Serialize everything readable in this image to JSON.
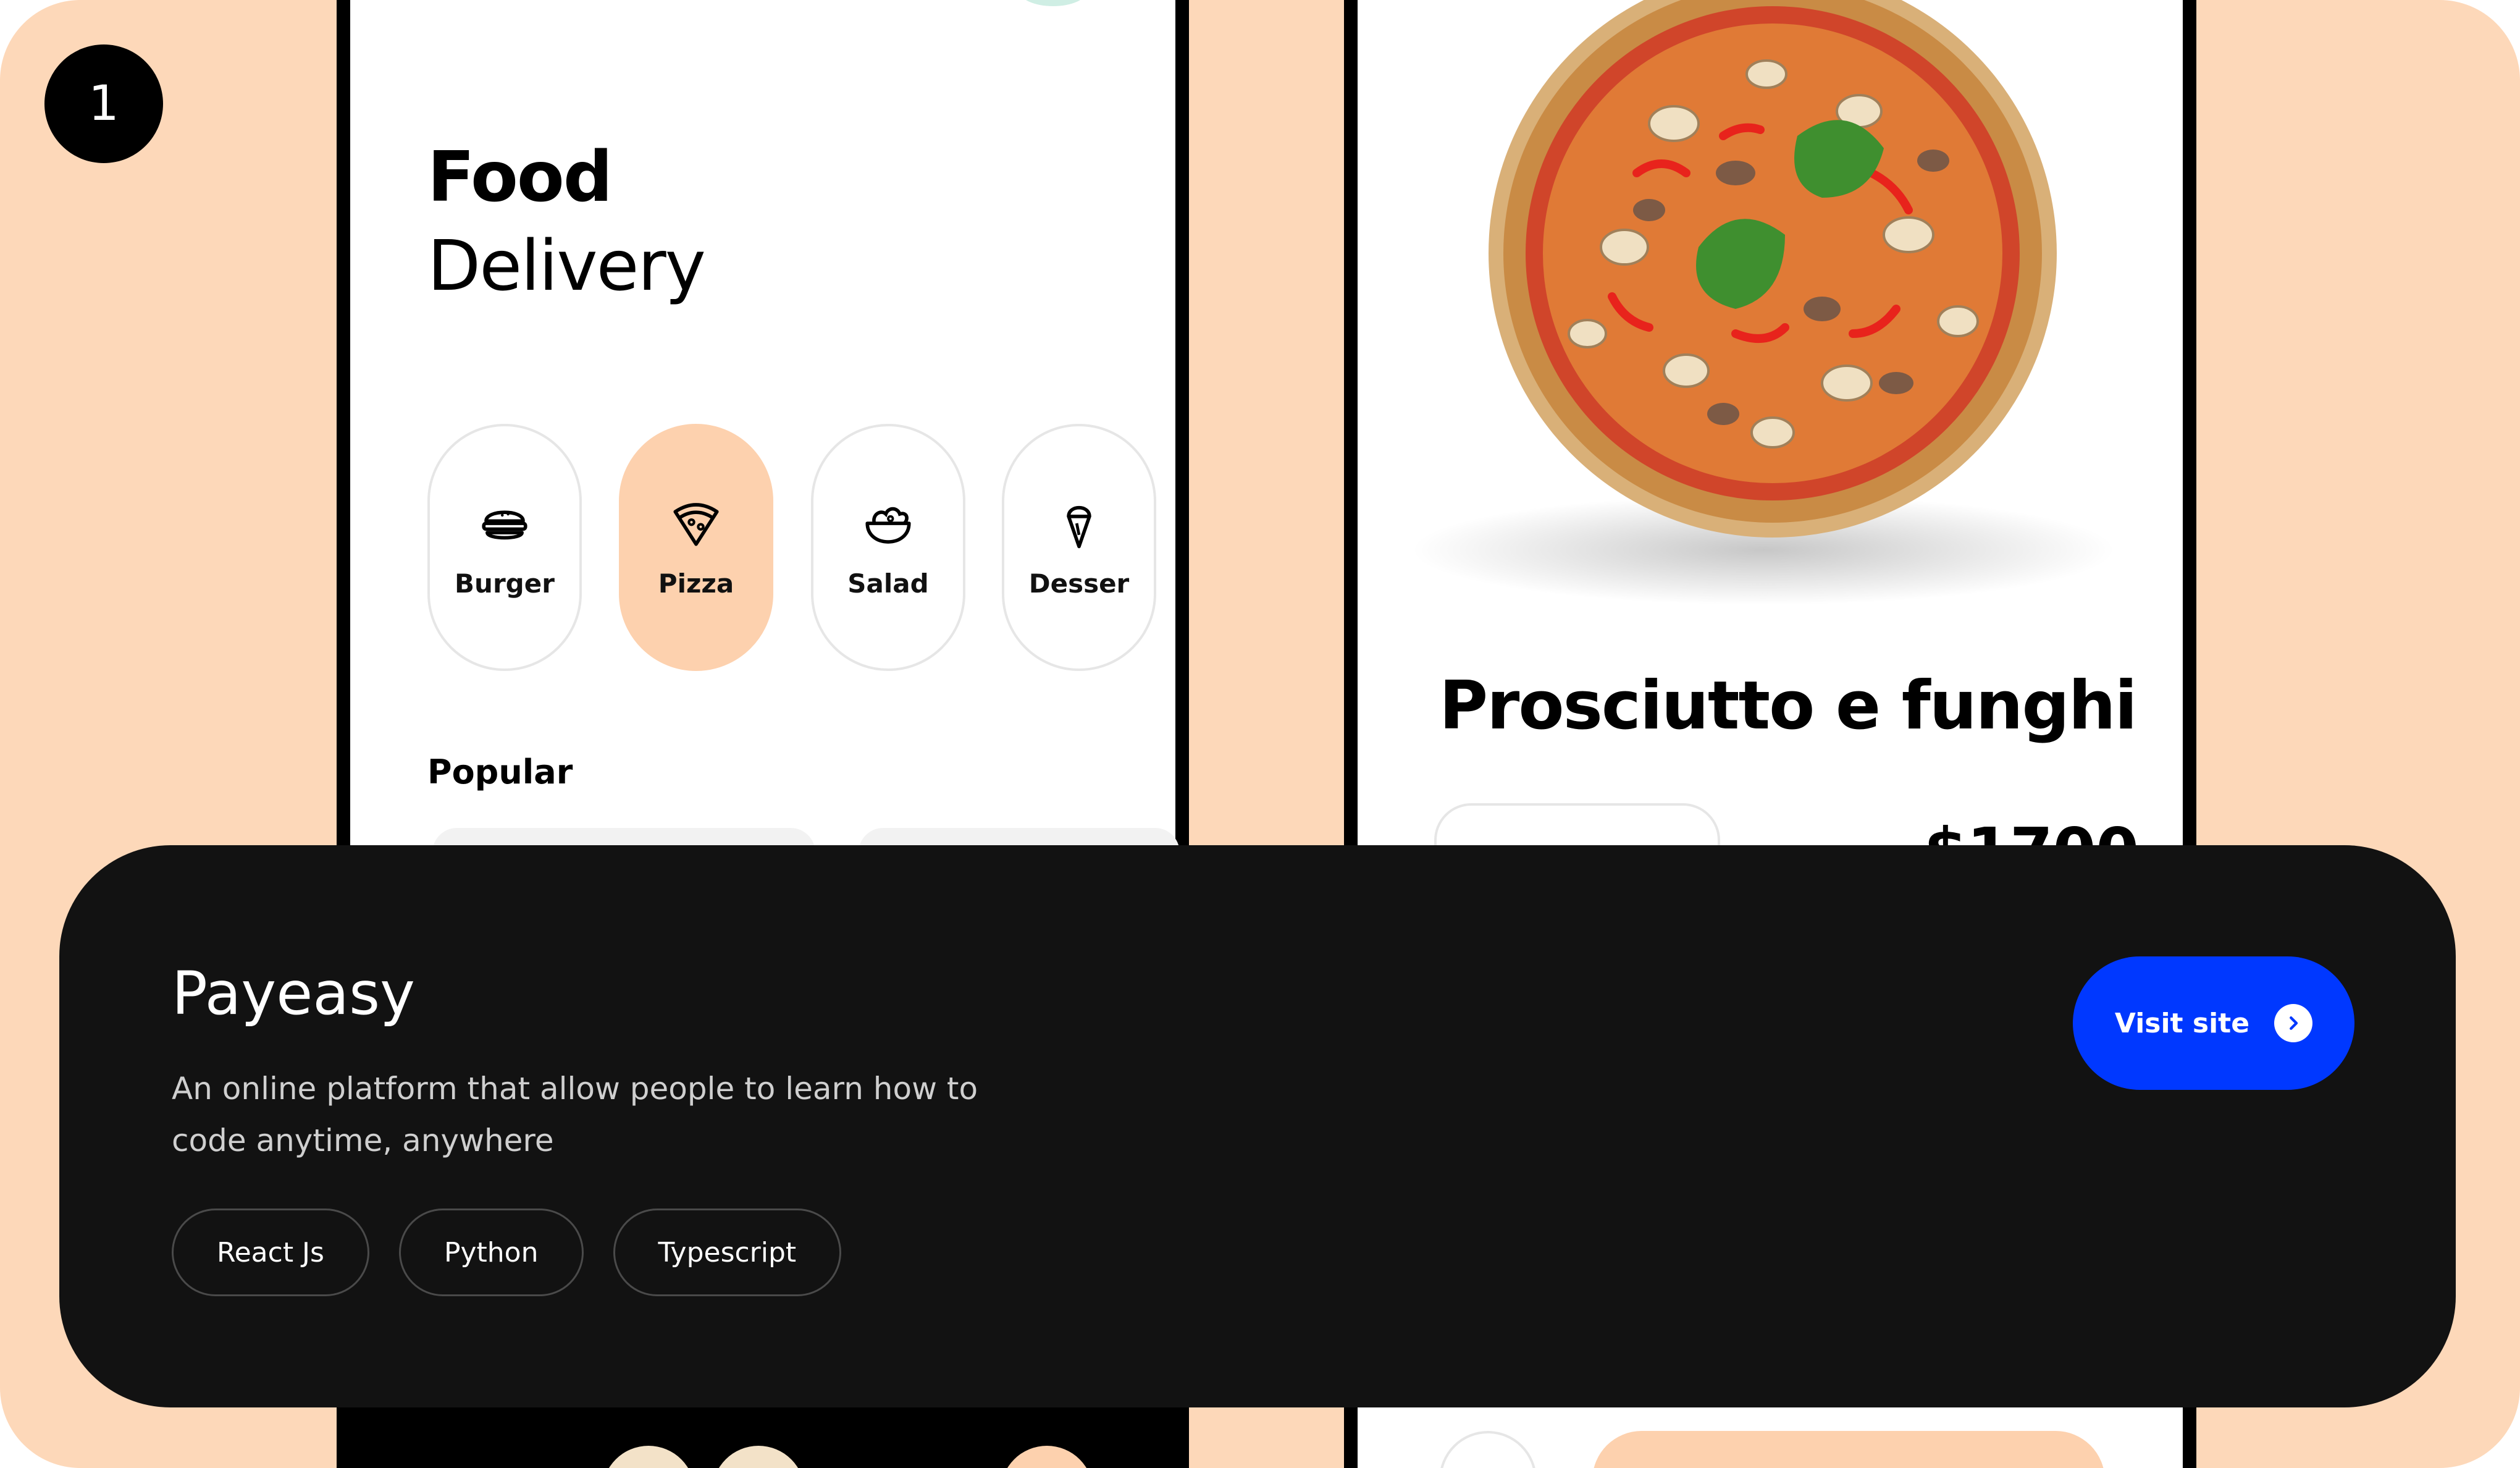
{
  "badge": {
    "number": "1"
  },
  "left_phone": {
    "title_bold": "Food",
    "title_light": "Delivery",
    "categories": [
      {
        "label": "Burger",
        "icon": "burger-icon",
        "active": false
      },
      {
        "label": "Pizza",
        "icon": "pizza-icon",
        "active": true
      },
      {
        "label": "Salad",
        "icon": "salad-icon",
        "active": false
      },
      {
        "label": "Desser",
        "icon": "ice-cream-icon",
        "active": false
      }
    ],
    "section_title": "Popular"
  },
  "right_phone": {
    "dish_name": "Prosciutto e funghi",
    "price": "$1700"
  },
  "project": {
    "title": "Payeasy",
    "description": "An online platform that allow people to learn how to code anytime, anywhere",
    "tags": [
      "React Js",
      "Python",
      "Typescript"
    ],
    "cta_label": "Visit site",
    "cta_icon": "chevron-right-circle-icon"
  },
  "colors": {
    "background": "#fdd8b9",
    "panel": "#121212",
    "cta": "#0038ff",
    "active_category": "#fdd1ae"
  }
}
